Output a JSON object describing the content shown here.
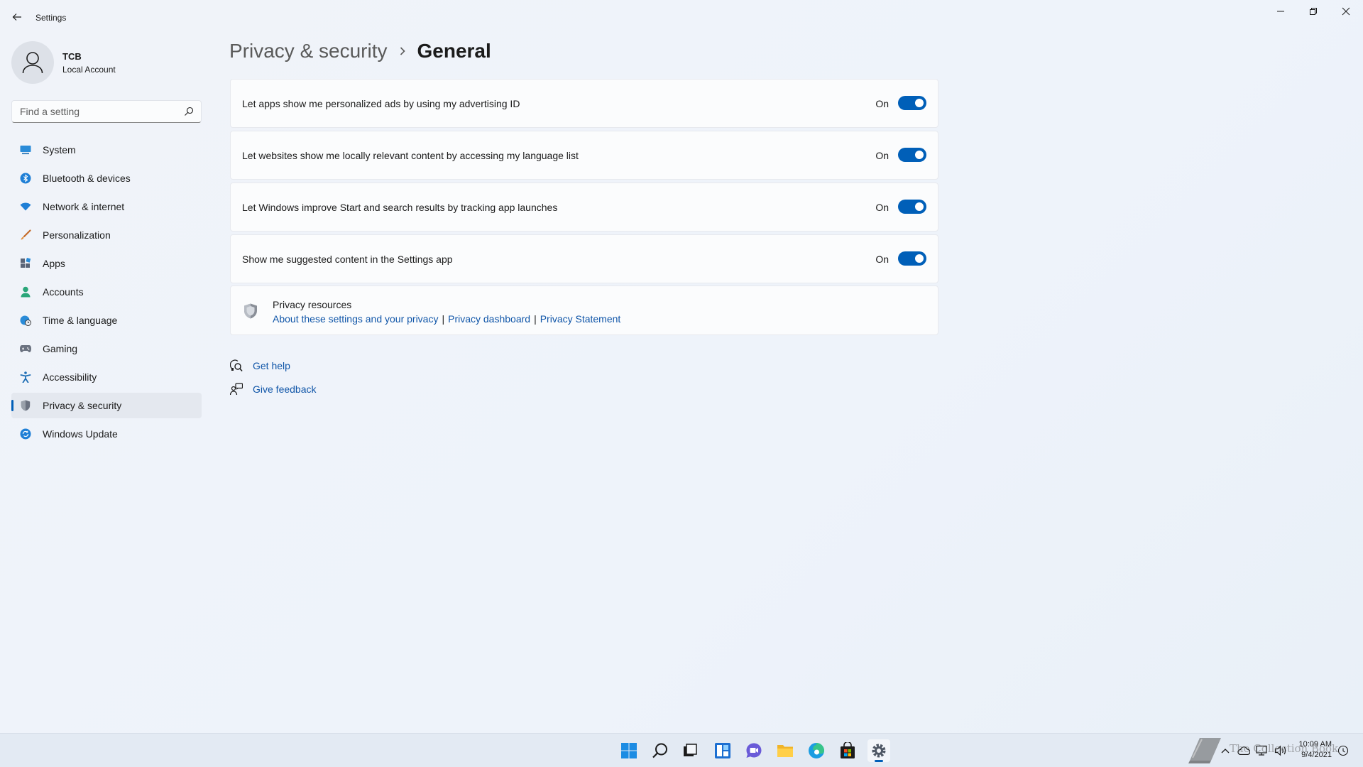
{
  "window": {
    "app_title": "Settings"
  },
  "profile": {
    "name": "TCB",
    "account_type": "Local Account"
  },
  "search": {
    "placeholder": "Find a setting"
  },
  "sidebar": {
    "items": [
      {
        "label": "System",
        "icon": "system-icon"
      },
      {
        "label": "Bluetooth & devices",
        "icon": "bluetooth-icon"
      },
      {
        "label": "Network & internet",
        "icon": "wifi-icon"
      },
      {
        "label": "Personalization",
        "icon": "brush-icon"
      },
      {
        "label": "Apps",
        "icon": "apps-icon"
      },
      {
        "label": "Accounts",
        "icon": "person-icon"
      },
      {
        "label": "Time & language",
        "icon": "globe-clock-icon"
      },
      {
        "label": "Gaming",
        "icon": "gamepad-icon"
      },
      {
        "label": "Accessibility",
        "icon": "accessibility-icon"
      },
      {
        "label": "Privacy & security",
        "icon": "shield-icon",
        "selected": true
      },
      {
        "label": "Windows Update",
        "icon": "update-icon"
      }
    ]
  },
  "breadcrumb": {
    "parent": "Privacy & security",
    "current": "General"
  },
  "settings": [
    {
      "label": "Let apps show me personalized ads by using my advertising ID",
      "state": "On",
      "enabled": true
    },
    {
      "label": "Let websites show me locally relevant content by accessing my language list",
      "state": "On",
      "enabled": true
    },
    {
      "label": "Let Windows improve Start and search results by tracking app launches",
      "state": "On",
      "enabled": true
    },
    {
      "label": "Show me suggested content in the Settings app",
      "state": "On",
      "enabled": true
    }
  ],
  "privacy_resources": {
    "title": "Privacy resources",
    "links": [
      "About these settings and your privacy",
      "Privacy dashboard",
      "Privacy Statement"
    ],
    "separator": "|"
  },
  "help": {
    "get_help": "Get help",
    "give_feedback": "Give feedback"
  },
  "taskbar": {
    "time": "10:09 AM",
    "date": "9/4/2021",
    "watermark": "The Collection Book"
  },
  "colors": {
    "accent": "#005fb8",
    "link": "#0f55a8",
    "background": "#eef2f8"
  }
}
